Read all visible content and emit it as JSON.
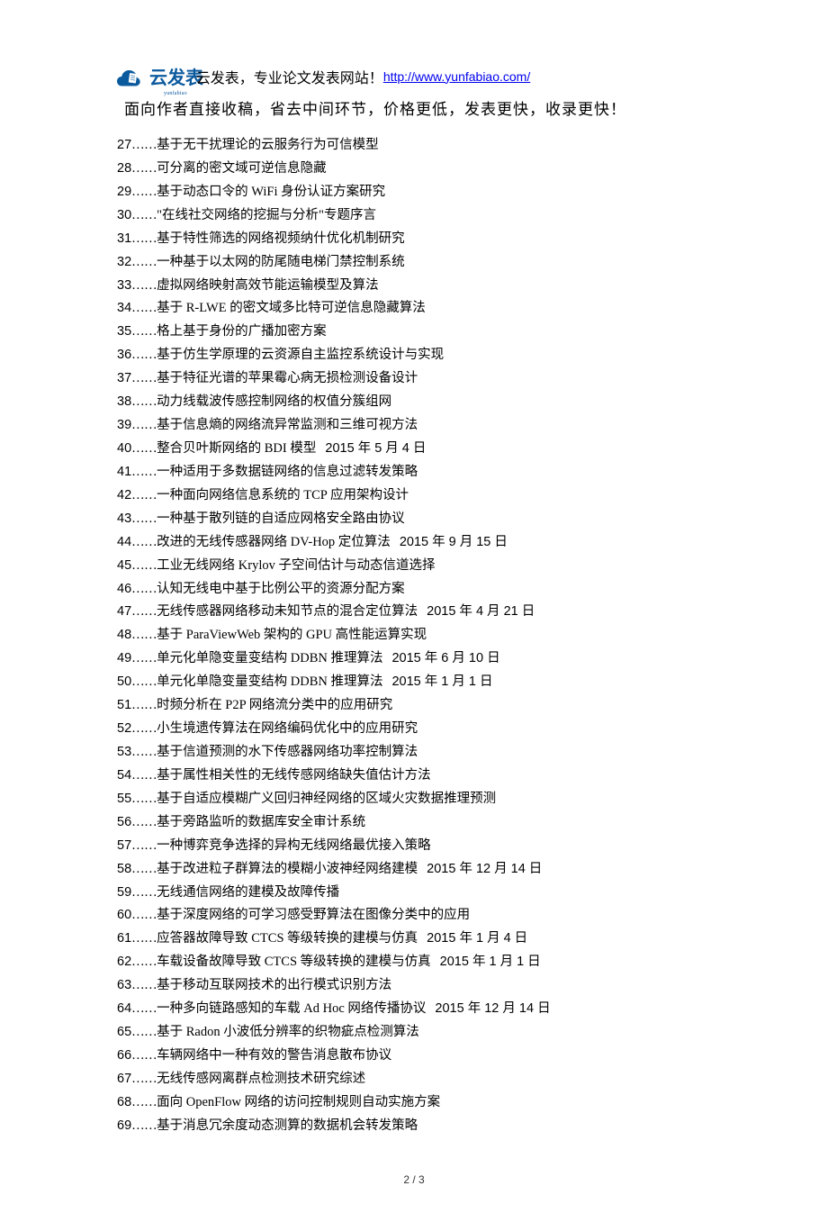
{
  "header": {
    "logo_brand": "云发表",
    "logo_pinyin": "yunfabiao",
    "line1_text": "云发表，专业论文发表网站！",
    "url": "http://www.yunfabiao.com/",
    "line2": "面向作者直接收稿，省去中间环节，价格更低，发表更快，收录更快！"
  },
  "list": [
    {
      "n": "27",
      "title": "基于无干扰理论的云服务行为可信模型"
    },
    {
      "n": "28",
      "title": "可分离的密文域可逆信息隐藏"
    },
    {
      "n": "29",
      "title": "基于动态口令的 WiFi 身份认证方案研究"
    },
    {
      "n": "30",
      "title": "\"在线社交网络的挖掘与分析\"专题序言"
    },
    {
      "n": "31",
      "title": "基于特性筛选的网络视频纳什优化机制研究"
    },
    {
      "n": "32",
      "title": "一种基于以太网的防尾随电梯门禁控制系统"
    },
    {
      "n": "33",
      "title": "虚拟网络映射高效节能运输模型及算法"
    },
    {
      "n": "34",
      "title": "基于 R-LWE 的密文域多比特可逆信息隐藏算法"
    },
    {
      "n": "35",
      "title": "格上基于身份的广播加密方案"
    },
    {
      "n": "36",
      "title": "基于仿生学原理的云资源自主监控系统设计与实现"
    },
    {
      "n": "37",
      "title": "基于特征光谱的苹果霉心病无损检测设备设计"
    },
    {
      "n": "38",
      "title": "动力线载波传感控制网络的权值分簇组网"
    },
    {
      "n": "39",
      "title": "基于信息熵的网络流异常监测和三维可视方法"
    },
    {
      "n": "40",
      "title": "整合贝叶斯网络的 BDI 模型",
      "date": "2015 年 5 月 4 日"
    },
    {
      "n": "41",
      "title": "一种适用于多数据链网络的信息过滤转发策略"
    },
    {
      "n": "42",
      "title": "一种面向网络信息系统的 TCP 应用架构设计"
    },
    {
      "n": "43",
      "title": "一种基于散列链的自适应网格安全路由协议"
    },
    {
      "n": "44",
      "title": "改进的无线传感器网络 DV-Hop 定位算法",
      "date": "2015 年 9 月 15 日"
    },
    {
      "n": "45",
      "title": "工业无线网络 Krylov 子空间估计与动态信道选择"
    },
    {
      "n": "46",
      "title": "认知无线电中基于比例公平的资源分配方案"
    },
    {
      "n": "47",
      "title": "无线传感器网络移动未知节点的混合定位算法",
      "date": "2015 年 4 月 21 日"
    },
    {
      "n": "48",
      "title": "基于 ParaViewWeb 架构的 GPU 高性能运算实现"
    },
    {
      "n": "49",
      "title": "单元化单隐变量变结构 DDBN 推理算法",
      "date": "2015 年 6 月 10 日"
    },
    {
      "n": "50",
      "title": "单元化单隐变量变结构 DDBN 推理算法",
      "date": "2015 年 1 月 1 日"
    },
    {
      "n": "51",
      "title": "时频分析在 P2P 网络流分类中的应用研究"
    },
    {
      "n": "52",
      "title": "小生境遗传算法在网络编码优化中的应用研究"
    },
    {
      "n": "53",
      "title": "基于信道预测的水下传感器网络功率控制算法"
    },
    {
      "n": "54",
      "title": "基于属性相关性的无线传感网络缺失值估计方法"
    },
    {
      "n": "55",
      "title": "基于自适应模糊广义回归神经网络的区域火灾数据推理预测"
    },
    {
      "n": "56",
      "title": "基于旁路监听的数据库安全审计系统"
    },
    {
      "n": "57",
      "title": "一种博弈竞争选择的异构无线网络最优接入策略"
    },
    {
      "n": "58",
      "title": "基于改进粒子群算法的模糊小波神经网络建模",
      "date": "2015 年 12 月 14 日"
    },
    {
      "n": "59",
      "title": "无线通信网络的建模及故障传播"
    },
    {
      "n": "60",
      "title": "基于深度网络的可学习感受野算法在图像分类中的应用"
    },
    {
      "n": "61",
      "title": "应答器故障导致 CTCS 等级转换的建模与仿真",
      "date": "2015 年 1 月 4 日"
    },
    {
      "n": "62",
      "title": "车载设备故障导致 CTCS 等级转换的建模与仿真",
      "date": "2015 年 1 月 1 日"
    },
    {
      "n": "63",
      "title": "基于移动互联网技术的出行模式识别方法"
    },
    {
      "n": "64",
      "title": "一种多向链路感知的车载 Ad Hoc 网络传播协议",
      "date": "2015 年 12 月 14 日"
    },
    {
      "n": "65",
      "title": "基于 Radon 小波低分辨率的织物疵点检测算法"
    },
    {
      "n": "66",
      "title": "车辆网络中一种有效的警告消息散布协议"
    },
    {
      "n": "67",
      "title": "无线传感网离群点检测技术研究综述"
    },
    {
      "n": "68",
      "title": "面向 OpenFlow 网络的访问控制规则自动实施方案"
    },
    {
      "n": "69",
      "title": "基于消息冗余度动态测算的数据机会转发策略"
    }
  ],
  "footer": "2 / 3"
}
